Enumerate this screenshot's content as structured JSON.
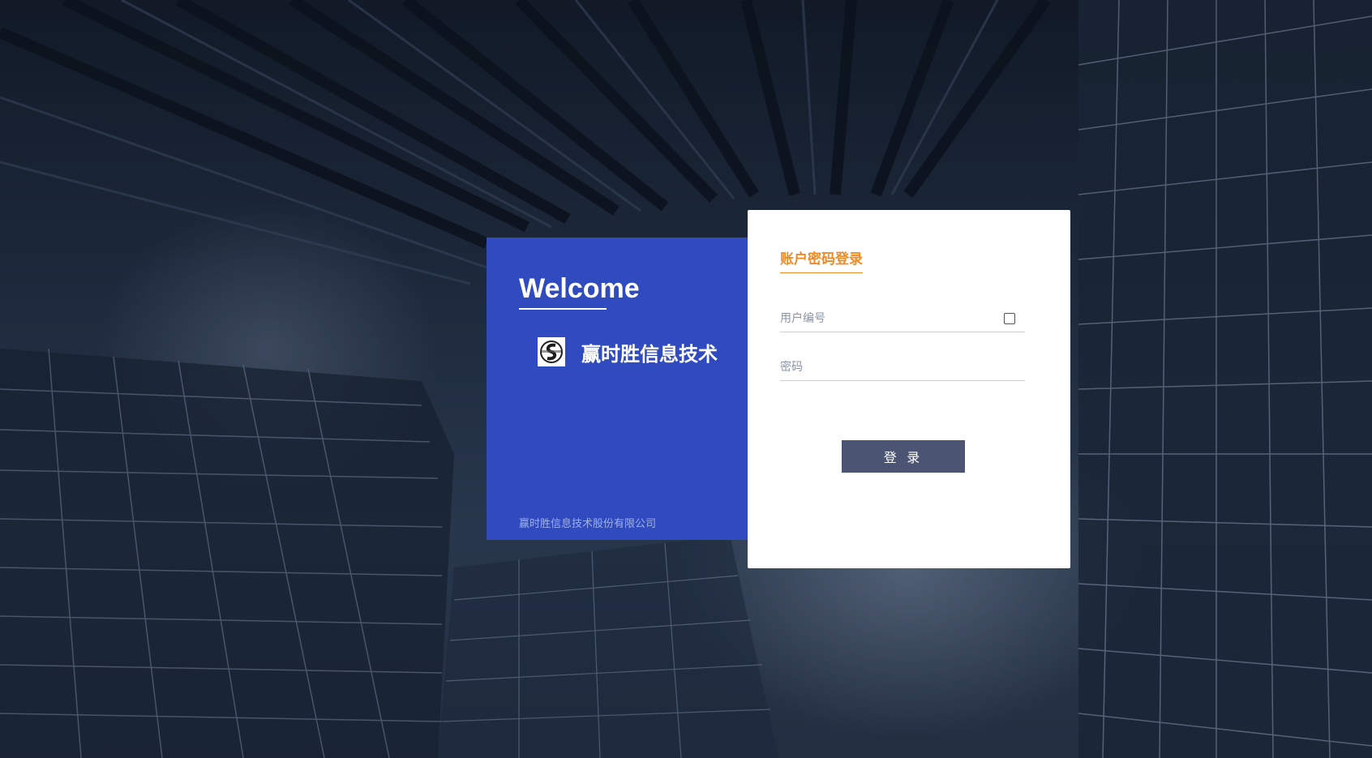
{
  "welcome": {
    "title": "Welcome",
    "brand_name": "赢时胜信息技术",
    "company": "赢时胜信息技术股份有限公司"
  },
  "login": {
    "tab_label": "账户密码登录",
    "username_placeholder": "用户编号",
    "password_placeholder": "密码",
    "submit_label": "登 录"
  },
  "colors": {
    "panel_blue": "#2f4bbf",
    "accent_orange": "#f08a24",
    "button": "#4b5573"
  },
  "icons": {
    "logo": "company-logo-icon",
    "checkbox": "checkbox-icon"
  }
}
